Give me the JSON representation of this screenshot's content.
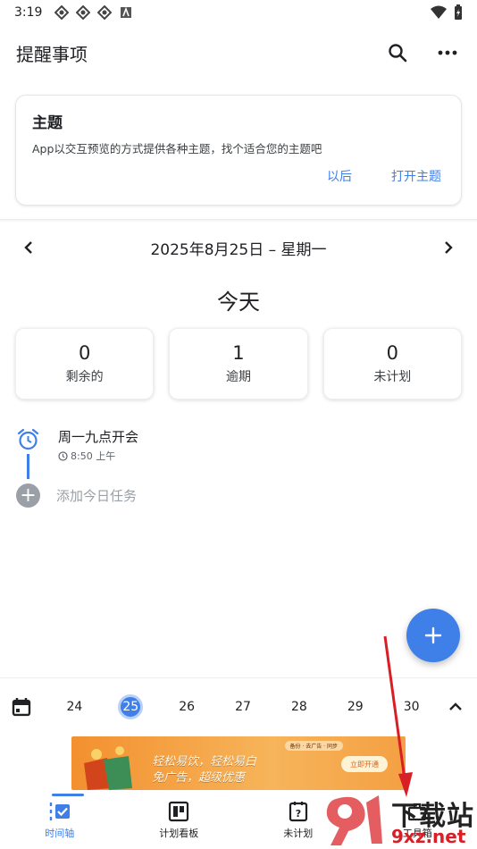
{
  "status_bar": {
    "time": "3:19"
  },
  "app_bar": {
    "title": "提醒事项"
  },
  "theme_card": {
    "title": "主题",
    "description": "App以交互预览的方式提供各种主题，找个适合您的主题吧",
    "later_label": "以后",
    "open_label": "打开主题"
  },
  "date_nav": {
    "date": "2025年8月25日 – 星期一"
  },
  "today_label": "今天",
  "stats": [
    {
      "value": "0",
      "label": "剩余的"
    },
    {
      "value": "1",
      "label": "逾期"
    },
    {
      "value": "0",
      "label": "未计划"
    }
  ],
  "tasks": [
    {
      "title": "周一九点开会",
      "time": "8:50 上午"
    }
  ],
  "add_task_label": "添加今日任务",
  "week_days": [
    "24",
    "25",
    "26",
    "27",
    "28",
    "29",
    "30"
  ],
  "selected_day": "25",
  "ad": {
    "line1": "轻松易饮，轻松易白",
    "line2": "免广告，超级优惠",
    "button": "立即开通",
    "tabs": "备份 · 去广告 · 同步"
  },
  "bottom_nav": [
    {
      "label": "时间轴",
      "icon": "timeline-icon",
      "active": true
    },
    {
      "label": "计划看板",
      "icon": "board-icon",
      "active": false
    },
    {
      "label": "未计划",
      "icon": "unplanned-icon",
      "active": false
    },
    {
      "label": "工具箱",
      "icon": "toolbox-icon",
      "active": false
    }
  ],
  "watermark": {
    "text": "下载站",
    "url": "9xz.net"
  },
  "colors": {
    "accent": "#3f7fe8",
    "text": "#202124",
    "muted": "#9aa0a6",
    "annotation": "#d81f26"
  }
}
